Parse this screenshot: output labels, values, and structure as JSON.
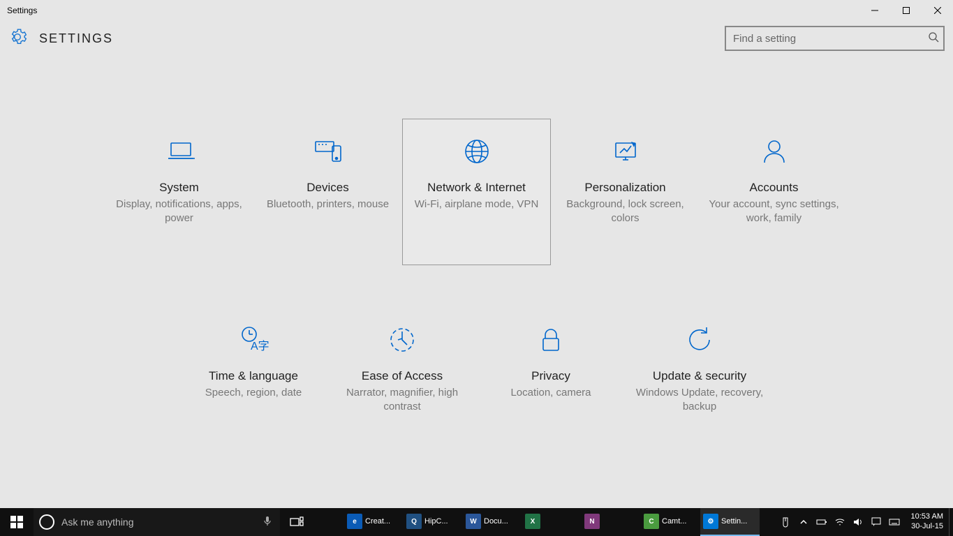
{
  "window": {
    "title": "Settings"
  },
  "header": {
    "title": "SETTINGS"
  },
  "search": {
    "placeholder": "Find a setting"
  },
  "tiles": [
    {
      "title": "System",
      "desc": "Display, notifications, apps, power",
      "selected": false,
      "icon": "laptop"
    },
    {
      "title": "Devices",
      "desc": "Bluetooth, printers, mouse",
      "selected": false,
      "icon": "devices"
    },
    {
      "title": "Network & Internet",
      "desc": "Wi-Fi, airplane mode, VPN",
      "selected": true,
      "icon": "globe"
    },
    {
      "title": "Personalization",
      "desc": "Background, lock screen, colors",
      "selected": false,
      "icon": "personalize"
    },
    {
      "title": "Accounts",
      "desc": "Your account, sync settings, work, family",
      "selected": false,
      "icon": "accounts"
    },
    {
      "title": "Time & language",
      "desc": "Speech, region, date",
      "selected": false,
      "icon": "time-language"
    },
    {
      "title": "Ease of Access",
      "desc": "Narrator, magnifier, high contrast",
      "selected": false,
      "icon": "ease-of-access"
    },
    {
      "title": "Privacy",
      "desc": "Location, camera",
      "selected": false,
      "icon": "privacy"
    },
    {
      "title": "Update & security",
      "desc": "Windows Update, recovery, backup",
      "selected": false,
      "icon": "update"
    }
  ],
  "taskbar": {
    "cortana_placeholder": "Ask me anything",
    "apps": [
      {
        "label": "Creat...",
        "icon": "edge",
        "glyph": "e"
      },
      {
        "label": "HipC...",
        "icon": "hip",
        "glyph": "Q"
      },
      {
        "label": "Docu...",
        "icon": "word",
        "glyph": "W"
      },
      {
        "label": "",
        "icon": "excel",
        "glyph": "X"
      },
      {
        "label": "",
        "icon": "onenote",
        "glyph": "N"
      },
      {
        "label": "Camt...",
        "icon": "camt",
        "glyph": "C"
      },
      {
        "label": "Settin...",
        "icon": "settings",
        "glyph": "⚙",
        "active": true
      }
    ],
    "clock": {
      "time": "10:53 AM",
      "date": "30-Jul-15"
    }
  }
}
